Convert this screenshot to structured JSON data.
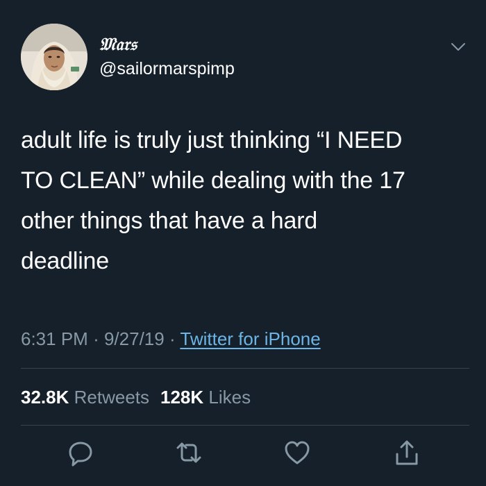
{
  "tweet": {
    "author": {
      "display_name": "𝔐𝔞𝔯𝔰",
      "handle": "@sailormarspimp"
    },
    "text_lines": [
      "adult life is truly just thinking “I NEED",
      "TO CLEAN” while dealing with the 17",
      "other things that have a hard",
      "deadline"
    ],
    "time": "6:31 PM",
    "separator": "·",
    "date": "9/27/19",
    "source": "Twitter for iPhone",
    "retweets_count": "32.8K",
    "retweets_label": "Retweets",
    "likes_count": "128K",
    "likes_label": "Likes"
  },
  "icons": {
    "menu": "chevron-down-icon",
    "reply": "reply-icon",
    "retweet": "retweet-icon",
    "like": "heart-icon",
    "share": "share-icon"
  },
  "colors": {
    "background": "#15202b",
    "text": "#ffffff",
    "secondary": "#8899a6",
    "link": "#6bb6e6",
    "divider": "#38444d"
  }
}
